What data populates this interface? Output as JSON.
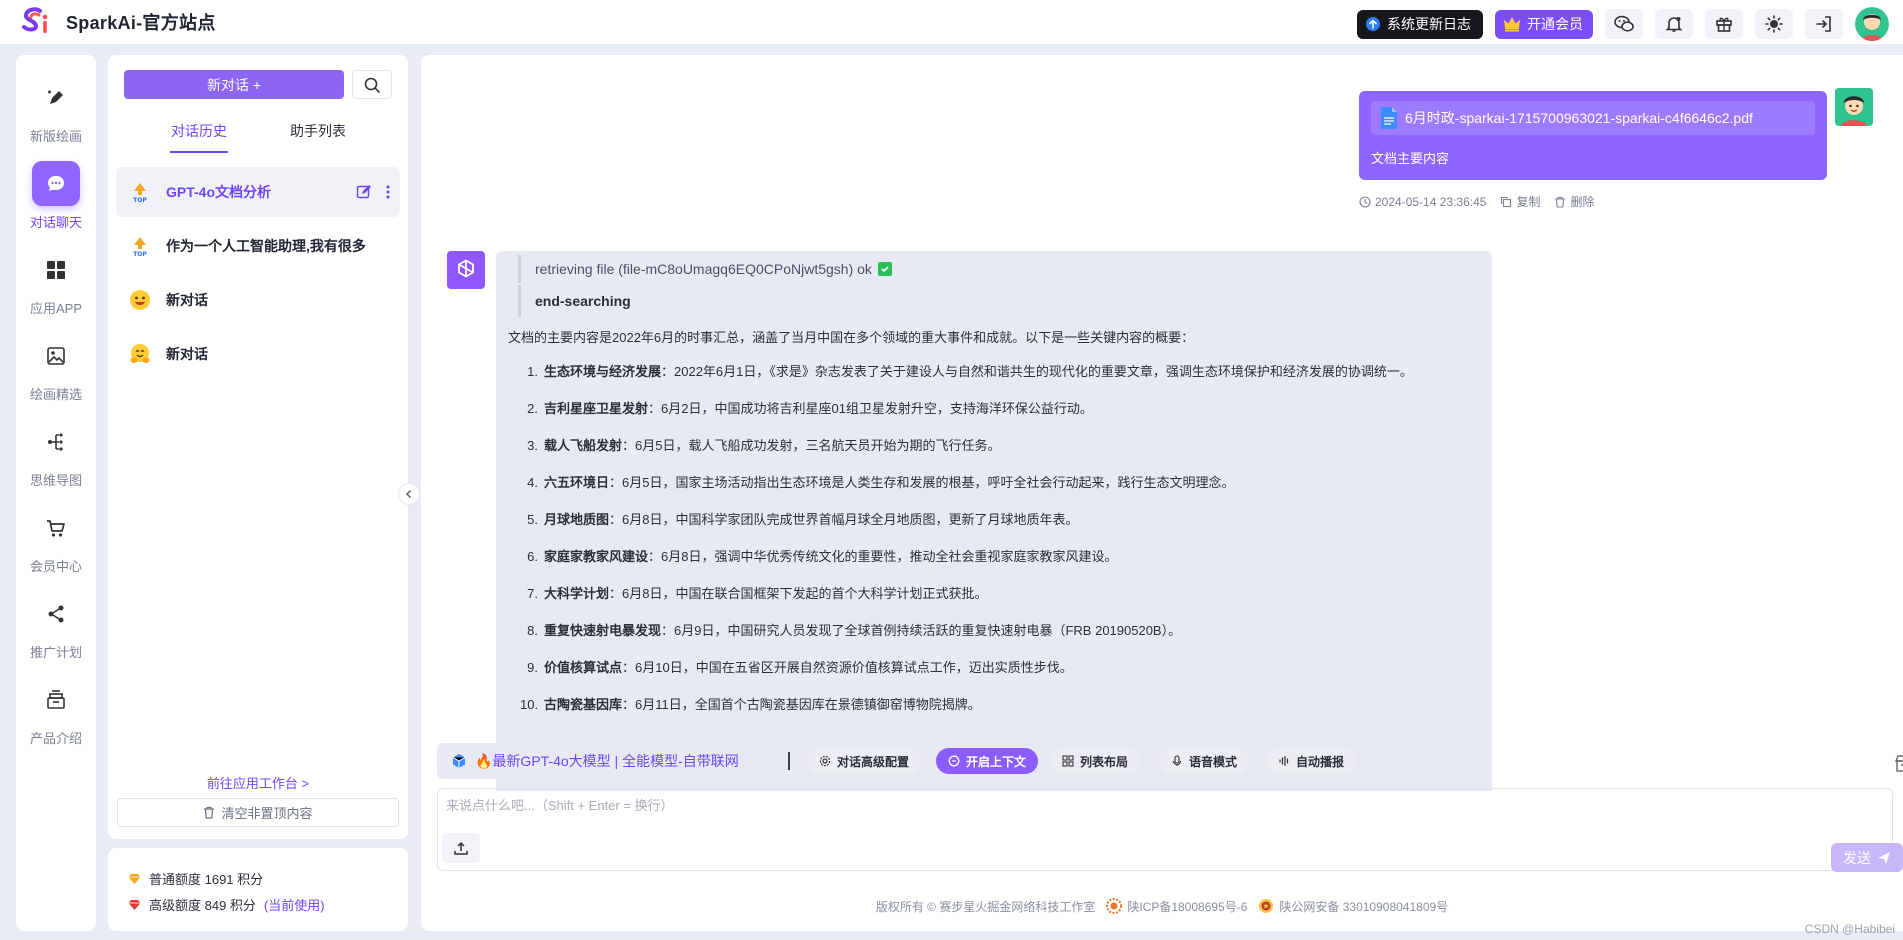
{
  "header": {
    "brand": "SparkAi-官方站点",
    "changelog_label": "系统更新日志",
    "vip_label": "开通会员"
  },
  "rail": {
    "items": [
      {
        "label": "新版绘画"
      },
      {
        "label": "对话聊天"
      },
      {
        "label": "应用APP"
      },
      {
        "label": "绘画精选"
      },
      {
        "label": "思维导图"
      },
      {
        "label": "会员中心"
      },
      {
        "label": "推广计划"
      },
      {
        "label": "产品介绍"
      }
    ]
  },
  "list": {
    "new_chat_label": "新对话 +",
    "tabs": [
      "对话历史",
      "助手列表"
    ],
    "conversations": [
      {
        "title": "GPT-4o文档分析"
      },
      {
        "title": "作为一个人工智能助理,我有很多"
      },
      {
        "title": "新对话"
      },
      {
        "title": "新对话"
      }
    ],
    "goto_workbench": "前往应用工作台 >",
    "clear_label": "清空非置顶内容"
  },
  "credits": {
    "normal": "普通额度 1691 积分",
    "advanced": "高级额度 849 积分",
    "advanced_link": "(当前使用)"
  },
  "chat": {
    "user": {
      "file_name": "6月时政-sparkai-1715700963021-sparkai-c4f6646c2.pdf",
      "text": "文档主要内容",
      "time": "2024-05-14 23:36:45",
      "copy_label": "复制",
      "delete_label": "删除"
    },
    "bot": {
      "retrieve": "retrieving file (file-mC8oUmagq6EQ0CPoNjwt5gsh) ok",
      "searching": "end-searching",
      "intro": "文档的主要内容是2022年6月的时事汇总，涵盖了当月中国在多个领域的重大事件和成就。以下是一些关键内容的概要：",
      "items": [
        {
          "n": "1.",
          "head": "生态环境与经济发展",
          "body": "：2022年6月1日，《求是》杂志发表了关于建设人与自然和谐共生的现代化的重要文章，强调生态环境保护和经济发展的协调统一。"
        },
        {
          "n": "2.",
          "head": "吉利星座卫星发射",
          "body": "：6月2日，中国成功将吉利星座01组卫星发射升空，支持海洋环保公益行动。"
        },
        {
          "n": "3.",
          "head": "载人飞船发射",
          "body": "：6月5日，载人飞船成功发射，三名航天员开始为期的飞行任务。"
        },
        {
          "n": "4.",
          "head": "六五环境日",
          "body": "：6月5日，国家主场活动指出生态环境是人类生存和发展的根基，呼吁全社会行动起来，践行生态文明理念。"
        },
        {
          "n": "5.",
          "head": "月球地质图",
          "body": "：6月8日，中国科学家团队完成世界首幅月球全月地质图，更新了月球地质年表。"
        },
        {
          "n": "6.",
          "head": "家庭家教家风建设",
          "body": "：6月8日，强调中华优秀传统文化的重要性，推动全社会重视家庭家教家风建设。"
        },
        {
          "n": "7.",
          "head": "大科学计划",
          "body": "：6月8日，中国在联合国框架下发起的首个大科学计划正式获批。"
        },
        {
          "n": "8.",
          "head": "重复快速射电暴发现",
          "body": "：6月9日，中国研究人员发现了全球首例持续活跃的重复快速射电暴（FRB 20190520B）。"
        },
        {
          "n": "9.",
          "head": "价值核算试点",
          "body": "：6月10日，中国在五省区开展自然资源价值核算试点工作，迈出实质性步伐。"
        },
        {
          "n": "10.",
          "head": "古陶瓷基因库",
          "body": "：6月11日，全国首个古陶瓷基因库在景德镇御窑博物院揭牌。"
        }
      ]
    }
  },
  "toolbar": {
    "model_label": "🔥最新GPT-4o大模型 | 全能模型-自带联网",
    "buttons": [
      "对话高级配置",
      "开启上下文",
      "列表布局",
      "语音模式",
      "自动播报"
    ]
  },
  "input": {
    "placeholder": "来说点什么吧...（Shift + Enter = 换行）",
    "send_label": "发送"
  },
  "footer": {
    "copyright": "版权所有 © 赛步星火掘金网络科技工作室",
    "icp": "陕ICP备18008695号-6",
    "police": "陕公网安备 33010908041809号"
  },
  "watermark": "CSDN @Habibei",
  "colors": {
    "accent": "#7c4dff",
    "bubble_user": "#8d66ff",
    "bubble_bot": "#e7eaf3"
  }
}
